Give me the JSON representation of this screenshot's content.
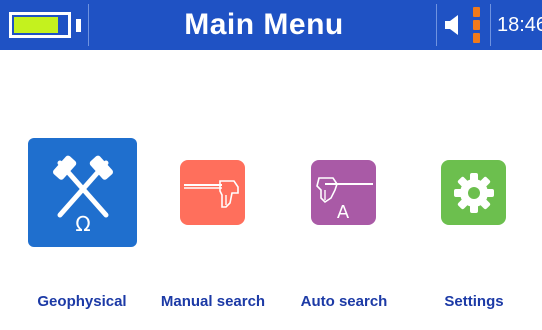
{
  "header": {
    "title": "Main Menu",
    "time": "18:46",
    "battery_level": 0.85,
    "battery_icon": "battery-icon",
    "speaker_icon": "speaker-icon",
    "signal_icon": "signal-bars-icon"
  },
  "colors": {
    "header_bg": "#1f52c4",
    "battery_fill": "#c4f21e",
    "label": "#1c3aa6",
    "tile_geophysical": "#1f6fce",
    "tile_manual": "#ff6f5c",
    "tile_auto": "#a95aa6",
    "tile_settings": "#6cbf4e"
  },
  "menu": {
    "items": [
      {
        "label": "Geophysical",
        "icon": "crossed-hammers-omega-icon",
        "selected": true
      },
      {
        "label": "Manual search",
        "icon": "detector-probe-icon",
        "selected": false
      },
      {
        "label": "Auto search",
        "icon": "detector-probe-auto-icon",
        "selected": false
      },
      {
        "label": "Settings",
        "icon": "gear-icon",
        "selected": false
      }
    ]
  }
}
